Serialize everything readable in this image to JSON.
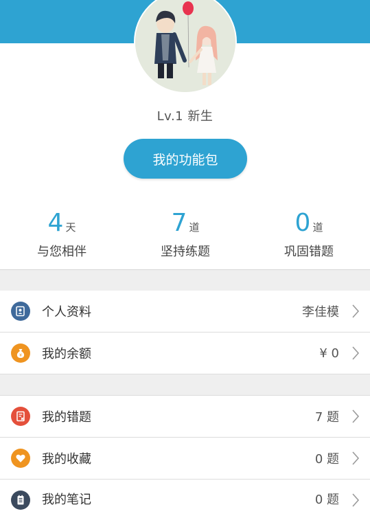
{
  "profile": {
    "level_text": "Lv.1  新生"
  },
  "actions": {
    "pack_button": "我的功能包"
  },
  "stats": [
    {
      "num": "4",
      "unit": "天",
      "label": "与您相伴"
    },
    {
      "num": "7",
      "unit": "道",
      "label": "坚持练题"
    },
    {
      "num": "0",
      "unit": "道",
      "label": "巩固错题"
    }
  ],
  "menu": {
    "profile": {
      "label": "个人资料",
      "value": "李佳模",
      "icon": "profile-card-icon",
      "color": "#3f6a9b"
    },
    "balance": {
      "label": "我的余额",
      "value": "¥ 0",
      "icon": "money-bag-icon",
      "color": "#ef9420"
    },
    "mistakes": {
      "label": "我的错题",
      "value": "7 题",
      "icon": "wrong-doc-icon",
      "color": "#e4503b"
    },
    "favorites": {
      "label": "我的收藏",
      "value": "0 题",
      "icon": "heart-icon",
      "color": "#ef9420"
    },
    "notes": {
      "label": "我的笔记",
      "value": "0 题",
      "icon": "notebook-icon",
      "color": "#3b4a5e"
    }
  },
  "colors": {
    "accent": "#2ea3d2",
    "divider": "#dcdcdc",
    "gap": "#efefef"
  }
}
